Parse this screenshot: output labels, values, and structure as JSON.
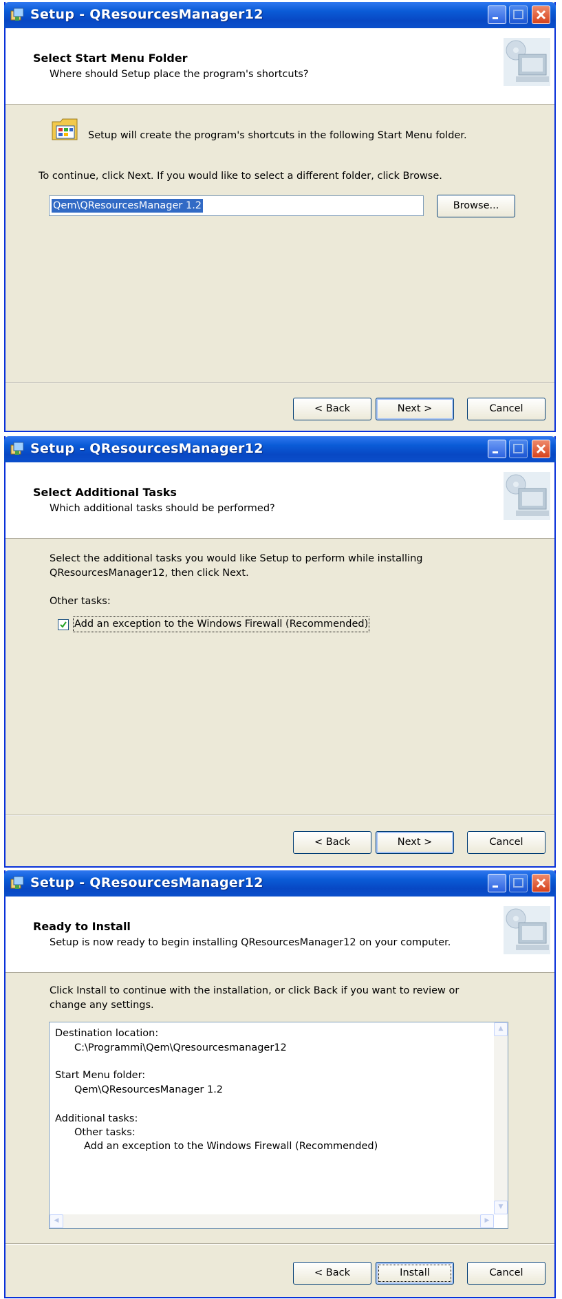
{
  "window_title": "Setup - QResourcesManager12",
  "buttons": {
    "back": "< Back",
    "next": "Next >",
    "cancel": "Cancel",
    "install": "Install",
    "browse": "Browse..."
  },
  "screen1": {
    "header_title": "Select Start Menu Folder",
    "header_subtitle": "Where should Setup place the program's shortcuts?",
    "info_text": "Setup will create the program's shortcuts in the following Start Menu folder.",
    "instruction_text": "To continue, click Next. If you would like to select a different folder, click Browse.",
    "folder_value": "Qem\\QResourcesManager 1.2"
  },
  "screen2": {
    "header_title": "Select Additional Tasks",
    "header_subtitle": "Which additional tasks should be performed?",
    "instruction_line1": "Select the additional tasks you would like Setup to perform while installing",
    "instruction_line2": "QResourcesManager12, then click Next.",
    "group_label": "Other tasks:",
    "firewall_task": "Add an exception to the Windows Firewall (Recommended)",
    "firewall_checked": true
  },
  "screen3": {
    "header_title": "Ready to Install",
    "header_subtitle": "Setup is now ready to begin installing QResourcesManager12 on your computer.",
    "instruction_line1": "Click Install to continue with the installation, or click Back if you want to review or",
    "instruction_line2": "change any settings.",
    "summary": {
      "dest_label": "Destination location:",
      "dest_value": "C:\\Programmi\\Qem\\Qresourcesmanager12",
      "start_label": "Start Menu folder:",
      "start_value": "Qem\\QResourcesManager 1.2",
      "tasks_label": "Additional tasks:",
      "tasks_group": "Other tasks:",
      "tasks_value": "Add an exception to the Windows Firewall (Recommended)"
    }
  }
}
